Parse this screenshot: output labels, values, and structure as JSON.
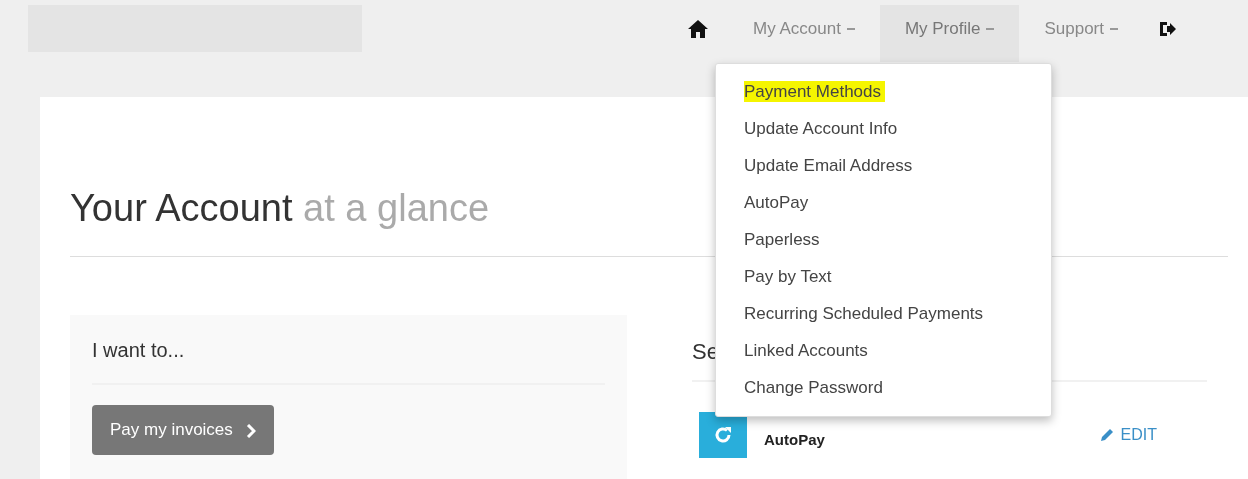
{
  "navbar": {
    "items": [
      {
        "kind": "home"
      },
      {
        "kind": "menu",
        "label": "My Account",
        "selected": false
      },
      {
        "kind": "menu",
        "label": "My Profile",
        "selected": true
      },
      {
        "kind": "menu",
        "label": "Support",
        "selected": false
      },
      {
        "kind": "logout"
      }
    ]
  },
  "dropdown": {
    "items": [
      {
        "label": "Payment Methods",
        "highlighted": true
      },
      {
        "label": "Update Account Info",
        "highlighted": false
      },
      {
        "label": "Update Email Address",
        "highlighted": false
      },
      {
        "label": "AutoPay",
        "highlighted": false
      },
      {
        "label": "Paperless",
        "highlighted": false
      },
      {
        "label": "Pay by Text",
        "highlighted": false
      },
      {
        "label": "Recurring Scheduled Payments",
        "highlighted": false
      },
      {
        "label": "Linked Accounts",
        "highlighted": false
      },
      {
        "label": "Change Password",
        "highlighted": false
      }
    ]
  },
  "heading": {
    "main": "Your Account",
    "muted": "at a glance"
  },
  "actions_card": {
    "title": "I want to...",
    "button": "Pay my invoices"
  },
  "settings": {
    "title": "Se",
    "rows": [
      {
        "label": "AutoPay",
        "action": "EDIT"
      }
    ]
  }
}
